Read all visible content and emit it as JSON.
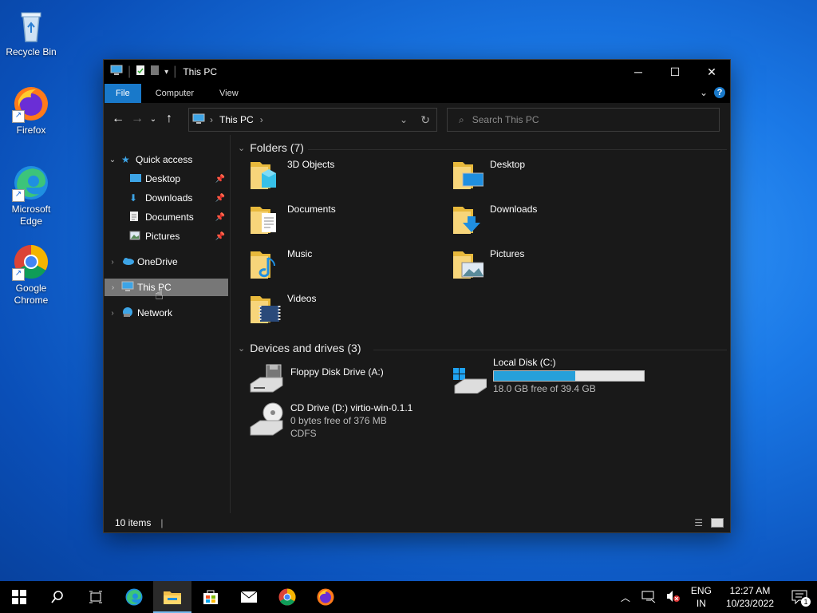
{
  "desktop": {
    "icons": [
      {
        "label": "Recycle Bin"
      },
      {
        "label": "Firefox"
      },
      {
        "label": "Microsoft Edge"
      },
      {
        "label": "Google Chrome"
      }
    ]
  },
  "window": {
    "title": "This PC",
    "ribbon_tabs": [
      "File",
      "Computer",
      "View"
    ],
    "address": {
      "path": "This PC"
    },
    "search": {
      "placeholder": "Search This PC"
    },
    "nav": {
      "quick_access": "Quick access",
      "pinned": [
        "Desktop",
        "Downloads",
        "Documents",
        "Pictures"
      ],
      "onedrive": "OneDrive",
      "this_pc": "This PC",
      "network": "Network"
    },
    "folders_header": "Folders (7)",
    "folders": [
      "3D Objects",
      "Desktop",
      "Documents",
      "Downloads",
      "Music",
      "Pictures",
      "Videos"
    ],
    "drives_header": "Devices and drives (3)",
    "drives": {
      "floppy": {
        "name": "Floppy Disk Drive (A:)"
      },
      "local": {
        "name": "Local Disk (C:)",
        "free": "18.0 GB free of 39.4 GB",
        "used_fraction": 0.543
      },
      "cd": {
        "name": "CD Drive (D:) virtio-win-0.1.1",
        "free": "0 bytes free of 376 MB",
        "fs": "CDFS"
      }
    },
    "status": {
      "items": "10 items"
    }
  },
  "taskbar": {
    "lang": {
      "top": "ENG",
      "bottom": "IN"
    },
    "time": "12:27 AM",
    "date": "10/23/2022",
    "notifications": "1"
  },
  "colors": {
    "accent": "#1979ca",
    "drive_fill": "#26a0da"
  }
}
